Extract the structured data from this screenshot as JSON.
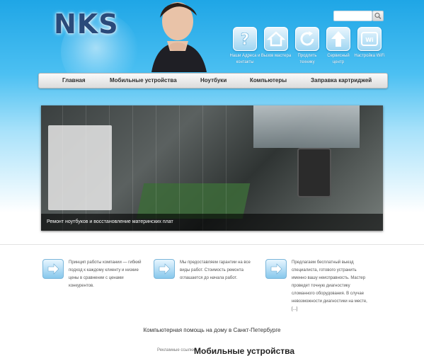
{
  "brand": {
    "logo_text": "NKS"
  },
  "search": {
    "placeholder": ""
  },
  "top_icons": [
    {
      "icon": "question-icon",
      "label": "Наши Адреса и контакты"
    },
    {
      "icon": "home-icon",
      "label": "Вызов мастера"
    },
    {
      "icon": "refresh-icon",
      "label": "Продлить технику"
    },
    {
      "icon": "upload-icon",
      "label": "Сервисный центр"
    },
    {
      "icon": "wifi-icon",
      "label": "Настройка WiFi"
    }
  ],
  "nav": {
    "items": [
      "Главная",
      "Мобильные устройства",
      "Ноутбуки",
      "Компьютеры",
      "Заправка картриджей"
    ]
  },
  "slider": {
    "caption": "Ремонт ноутбуков и восстановление материнских плат"
  },
  "features": [
    {
      "icon": "arrow-right-icon",
      "text": "Принцип работы компании — гибкий подход к каждому клиенту и низкие цены в сравнении с ценами конкурентов."
    },
    {
      "icon": "arrow-right-icon",
      "text": "Мы предоставляем гарантии на все виды работ. Стоимость ремонта оглашается до начала работ."
    },
    {
      "icon": "arrow-right-icon",
      "text": "Предлагаем бесплатный выезд специалиста, готового устранить именно вашу неисправность. Мастер проведет точную диагностику сломанного оборудования. В случае невозможности диагностики на месте, [...]"
    }
  ],
  "footer": {
    "tagline": "Компьютерная помощь на дому в Санкт-Петербурге",
    "small": "Рекламные ссылки",
    "heading": "Мобильные устройства"
  },
  "colors": {
    "header_top": "#1fa6e6",
    "header_mid": "#4cc0f2",
    "nav_bg": "#e8e8e8"
  }
}
